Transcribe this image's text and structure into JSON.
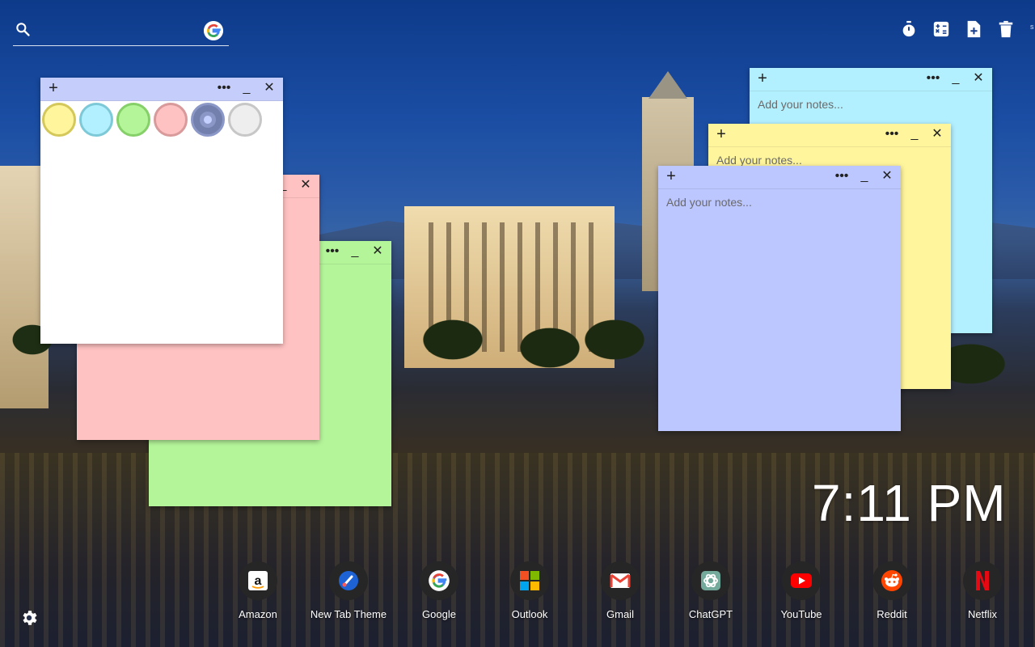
{
  "search": {
    "placeholder": "",
    "search_icon": "search-icon",
    "engine_icon": "google-icon"
  },
  "toolbar": {
    "items": [
      {
        "icon": "stopwatch-icon"
      },
      {
        "icon": "calculator-icon"
      },
      {
        "icon": "add-note-icon"
      },
      {
        "icon": "trash-icon"
      }
    ],
    "edge_glyph": "s"
  },
  "notes": {
    "placeholder": "Add your notes...",
    "add_glyph": "+",
    "menu_glyph": "•••",
    "minimize_glyph": "_",
    "close_glyph": "✕",
    "palette": [
      {
        "fill": "#fff59d",
        "ring": "#d4c85a",
        "name": "yellow"
      },
      {
        "fill": "#b3f0ff",
        "ring": "#7ec9d8",
        "name": "blue"
      },
      {
        "fill": "#b5f59a",
        "ring": "#86d06a",
        "name": "green"
      },
      {
        "fill": "#ffc2c2",
        "ring": "#d89a9a",
        "name": "pink"
      },
      {
        "fill": "#bcc6ff",
        "ring": "#8b98c7",
        "name": "lavender"
      },
      {
        "fill": "#eeeeee",
        "ring": "#c7c7c7",
        "name": "gray"
      }
    ],
    "colors": {
      "white": "#ffffff",
      "pink": "#ffc2c2",
      "green": "#b5f59a",
      "blue": "#b3f0ff",
      "yellow": "#fff59d",
      "lavender": "#bcc6ff"
    }
  },
  "clock": {
    "time": "7:11 PM"
  },
  "shortcuts": [
    {
      "label": "Amazon",
      "icon": "amazon-icon"
    },
    {
      "label": "New Tab Theme",
      "icon": "new-tab-theme-icon"
    },
    {
      "label": "Google",
      "icon": "google-icon"
    },
    {
      "label": "Outlook",
      "icon": "outlook-icon"
    },
    {
      "label": "Gmail",
      "icon": "gmail-icon"
    },
    {
      "label": "ChatGPT",
      "icon": "chatgpt-icon"
    },
    {
      "label": "YouTube",
      "icon": "youtube-icon"
    },
    {
      "label": "Reddit",
      "icon": "reddit-icon"
    },
    {
      "label": "Netflix",
      "icon": "netflix-icon"
    }
  ],
  "settings": {
    "icon": "gear-icon"
  }
}
